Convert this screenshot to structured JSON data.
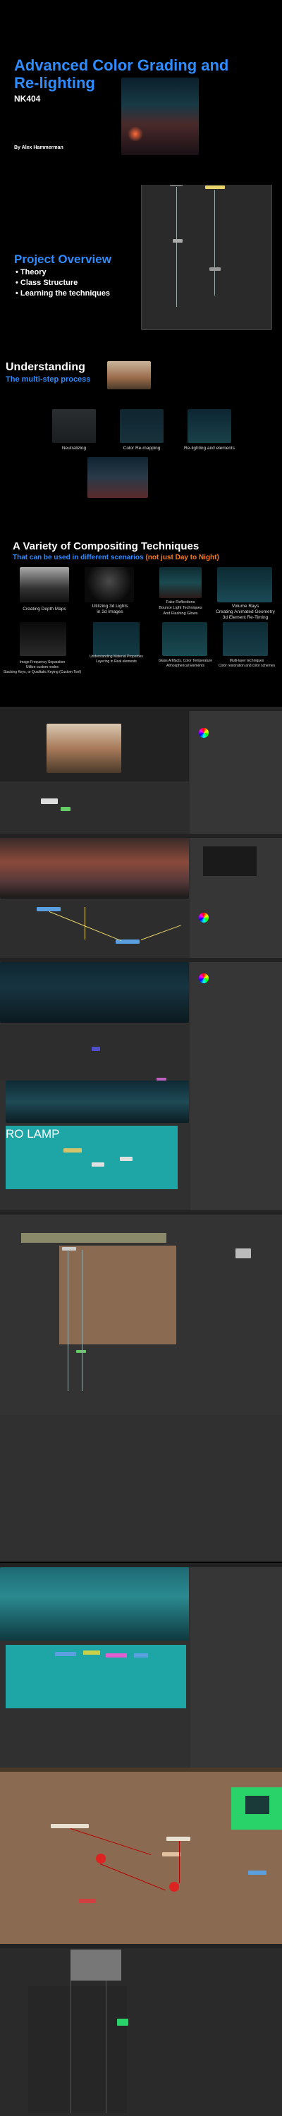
{
  "title_slide": {
    "title": "Advanced Color Grading and Re-lighting",
    "code": "NK404",
    "author": "By Alex Hammerman"
  },
  "overview": {
    "heading": "Project Overview",
    "bullets": [
      "Theory",
      "Class Structure",
      "Learning the techniques"
    ]
  },
  "understanding": {
    "heading": "Understanding",
    "subheading": "The multi-step process",
    "captions": [
      "Neutralizing",
      "Color Re-mapping",
      "Re-lighting and elements"
    ]
  },
  "techniques": {
    "heading": "A Variety of Compositing Techniques",
    "subheading": "That can be used in different scenarios",
    "subheading_note": "(not just Day to Night)",
    "captions_row1": [
      "Creating Depth Maps",
      "Utilizing 3d Lights\nin 2d Images",
      "Fake Reflections\nBounce Light Techniques\nAnd Flashing Glows",
      "Volume Rays\nCreating Animated Geometry\n3d Element Re-Timing"
    ],
    "captions_row2": [
      "Image Frequency Separation\nUtilize custom nodes\nStacking Keys, or Qualitatic Keying (Custom Tool)",
      "Understanding Material Properties\nLayering in Real elements",
      "Glass Artifacts, Color Temperature\nAtmospherical Elements",
      "Multi-layer techniques\nColor restoration and color schemes"
    ]
  },
  "screens": {
    "overlay_text": "RO LAMP"
  },
  "colors": {
    "accent_blue": "#2f8cff",
    "accent_orange": "#ff7a1a",
    "teal": "#1ea5a5",
    "nuke_bg": "#303030",
    "brown_bg": "#8a6a50"
  }
}
